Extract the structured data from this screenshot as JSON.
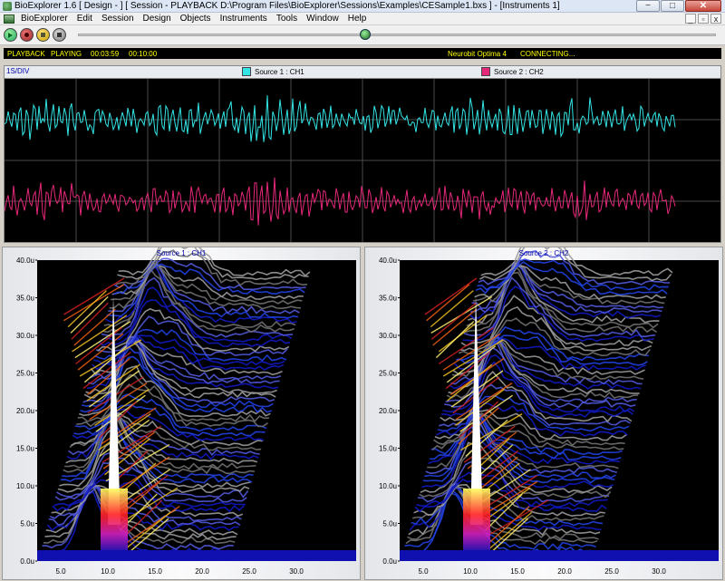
{
  "window": {
    "title": "BioExplorer 1.6  [ Design -  ] [ Session - PLAYBACK D:\\Program Files\\BioExplorer\\Sessions\\Examples\\CESample1.bxs ] - [Instruments 1]",
    "minimize": "−",
    "maximize": "□",
    "close": "✕"
  },
  "menu": {
    "items": [
      "BioExplorer",
      "Edit",
      "Session",
      "Design",
      "Objects",
      "Instruments",
      "Tools",
      "Window",
      "Help"
    ],
    "mdi_minimize": "_",
    "mdi_restore": "▫",
    "mdi_close": "x"
  },
  "toolbar": {
    "buttons": [
      "play-icon",
      "record-icon",
      "pause-icon",
      "stop-icon"
    ],
    "position_fraction": 0.45
  },
  "status": {
    "mode": "PLAYBACK",
    "state": "PLAYING",
    "elapsed": "00:03:59",
    "total": "00:10:00",
    "device": "Neurobit Optima 4",
    "connection": "CONNECTING..."
  },
  "waveform": {
    "time_div": "1S/DIV",
    "channels": [
      {
        "name": "Source 1 : CH1",
        "color": "#33e6e6"
      },
      {
        "name": "Source 2 : CH2",
        "color": "#e6287a"
      }
    ]
  },
  "spectrograms": [
    {
      "title": "Source 1 : CH1",
      "y_ticks": [
        "40.0u",
        "35.0u",
        "30.0u",
        "25.0u",
        "20.0u",
        "15.0u",
        "10.0u",
        "5.0u",
        "0.0u"
      ],
      "x_ticks": [
        "5.0",
        "10.0",
        "15.0",
        "20.0",
        "25.0",
        "30.0"
      ]
    },
    {
      "title": "Source 2 : CH2",
      "y_ticks": [
        "40.0u",
        "35.0u",
        "30.0u",
        "25.0u",
        "20.0u",
        "15.0u",
        "10.0u",
        "5.0u",
        "0.0u"
      ],
      "x_ticks": [
        "5.0",
        "10.0",
        "15.0",
        "20.0",
        "25.0",
        "30.0"
      ]
    }
  ],
  "colors": {
    "waveform_bg": "#000000",
    "status_text": "#ffff00",
    "label_blue": "#0000aa"
  }
}
